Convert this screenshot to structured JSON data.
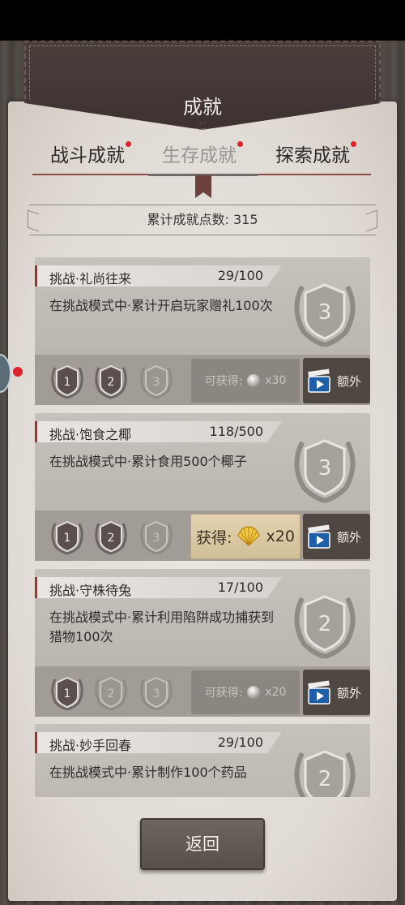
{
  "header": {
    "title": "成就"
  },
  "tabs": [
    {
      "label": "战斗成就",
      "active": false,
      "has_dot": true
    },
    {
      "label": "生存成就",
      "active": true,
      "has_dot": true
    },
    {
      "label": "探索成就",
      "active": false,
      "has_dot": true
    }
  ],
  "points": {
    "text": "累计成就点数: 315"
  },
  "achievements": [
    {
      "name": "挑战·礼尚往来",
      "progress": "29/100",
      "desc": "在挑战模式中·累计开启玩家赠礼100次",
      "badge_level": "3",
      "tiers": [
        "1",
        "2",
        "3"
      ],
      "tiers_completed": 2,
      "reward_label": "可获得:",
      "reward_amount": "x30",
      "reward_claimable": false,
      "extra_label": "额外"
    },
    {
      "name": "挑战·饱食之椰",
      "progress": "118/500",
      "desc": "在挑战模式中·累计食用500个椰子",
      "badge_level": "3",
      "tiers": [
        "1",
        "2",
        "3"
      ],
      "tiers_completed": 2,
      "reward_label": "获得:",
      "reward_amount": "x20",
      "reward_claimable": true,
      "extra_label": "额外"
    },
    {
      "name": "挑战·守株待兔",
      "progress": "17/100",
      "desc": "在挑战模式中·累计利用陷阱成功捕获到猎物100次",
      "badge_level": "2",
      "tiers": [
        "1",
        "2",
        "3"
      ],
      "tiers_completed": 1,
      "reward_label": "可获得:",
      "reward_amount": "x20",
      "reward_claimable": false,
      "extra_label": "额外"
    },
    {
      "name": "挑战·妙手回春",
      "progress": "29/100",
      "desc": "在挑战模式中·累计制作100个药品",
      "badge_level": "2"
    }
  ],
  "footer": {
    "back_label": "返回"
  },
  "colors": {
    "accent_red": "#e0222d",
    "card_border": "#a5302e",
    "back_button": "#5f5852"
  }
}
